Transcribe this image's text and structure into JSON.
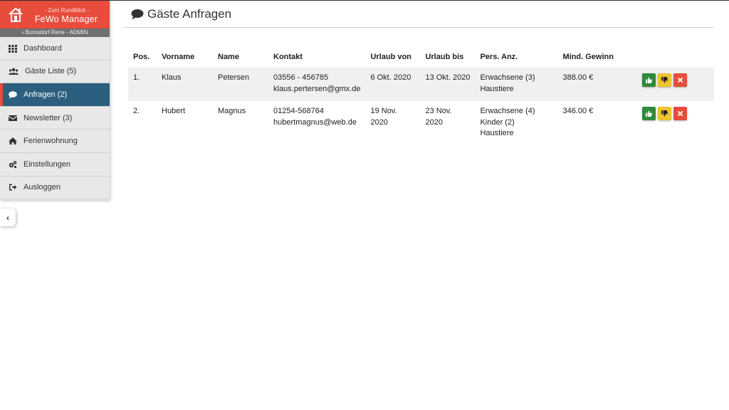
{
  "brand": {
    "subtitle": "- Zum Rundblick -",
    "title": "FeWo Manager",
    "user": "Bomsdorf Rene - ADMIN"
  },
  "sidebar": {
    "items": [
      {
        "label": "Dashboard",
        "icon": "grid-icon"
      },
      {
        "label": "Gäste Liste (5)",
        "icon": "users-icon"
      },
      {
        "label": "Anfragen (2)",
        "icon": "comment-icon",
        "active": true
      },
      {
        "label": "Newsletter (3)",
        "icon": "envelope-icon"
      },
      {
        "label": "Ferienwohnung",
        "icon": "home-icon"
      },
      {
        "label": "Einstellungen",
        "icon": "cogs-icon"
      },
      {
        "label": "Ausloggen",
        "icon": "sign-out-icon"
      }
    ]
  },
  "page": {
    "title": "Gäste Anfragen"
  },
  "table": {
    "headers": {
      "pos": "Pos.",
      "vorname": "Vorname",
      "name": "Name",
      "kontakt": "Kontakt",
      "von": "Urlaub von",
      "bis": "Urlaub bis",
      "pers": "Pers. Anz.",
      "gewinn": "Mind. Gewinn"
    },
    "rows": [
      {
        "pos": "1.",
        "vorname": "Klaus",
        "name": "Petersen",
        "phone": "03556 - 456785",
        "email": "klaus.pertersen@gmx.de",
        "von": "6 Okt. 2020",
        "bis": "13 Okt. 2020",
        "pers": [
          "Erwachsene (3)",
          "Haustiere"
        ],
        "gewinn": "388.00 €"
      },
      {
        "pos": "2.",
        "vorname": "Hubert",
        "name": "Magnus",
        "phone": "01254-568764",
        "email": "hubertmagnus@web.de",
        "von": "19 Nov. 2020",
        "bis": "23 Nov. 2020",
        "pers": [
          "Erwachsene (4)",
          "Kinder (2)",
          "Haustiere"
        ],
        "gewinn": "346.00 €"
      }
    ]
  },
  "colors": {
    "accent": "#e74c3c",
    "active_nav": "#2c5f7f",
    "accept": "#2e8b3a",
    "decline": "#f0c330",
    "delete": "#e74c3c"
  }
}
